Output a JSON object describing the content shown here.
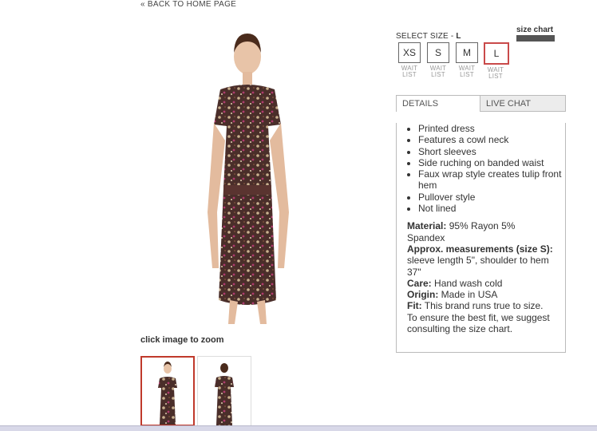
{
  "nav": {
    "back_arrow": "«",
    "back_label": "BACK TO HOME PAGE"
  },
  "product_image": {
    "zoom_hint": "click image to zoom",
    "thumbnail_count": 2,
    "selected_thumbnail": 1
  },
  "size": {
    "prompt": "SELECT SIZE - ",
    "selected": "L",
    "chart_label": "size chart",
    "options": [
      {
        "label": "XS",
        "status": "WAIT LIST"
      },
      {
        "label": "S",
        "status": "WAIT LIST"
      },
      {
        "label": "M",
        "status": "WAIT LIST"
      },
      {
        "label": "L",
        "status": "WAIT LIST"
      }
    ]
  },
  "tabs": [
    {
      "label": "DETAILS"
    },
    {
      "label": "LIVE CHAT"
    }
  ],
  "details": {
    "features": [
      "Printed dress",
      "Features a cowl neck",
      "Short sleeves",
      "Side ruching on banded waist",
      "Faux wrap style creates tulip front hem",
      "Pullover style",
      "Not lined"
    ],
    "material_label": "Material:",
    "material_value": " 95% Rayon 5% Spandex",
    "measure_label": "Approx. measurements (size S):",
    "measure_value": " sleeve length 5\", shoulder to hem 37\"",
    "care_label": "Care:",
    "care_value": " Hand wash cold",
    "origin_label": "Origin:",
    "origin_value": " Made in USA",
    "fit_label": "Fit:",
    "fit_value": " This brand runs true to size. To ensure the best fit, we suggest consulting the size chart."
  },
  "colors": {
    "accent_red": "#c0392b",
    "dress_base": "#4a2e2a"
  }
}
